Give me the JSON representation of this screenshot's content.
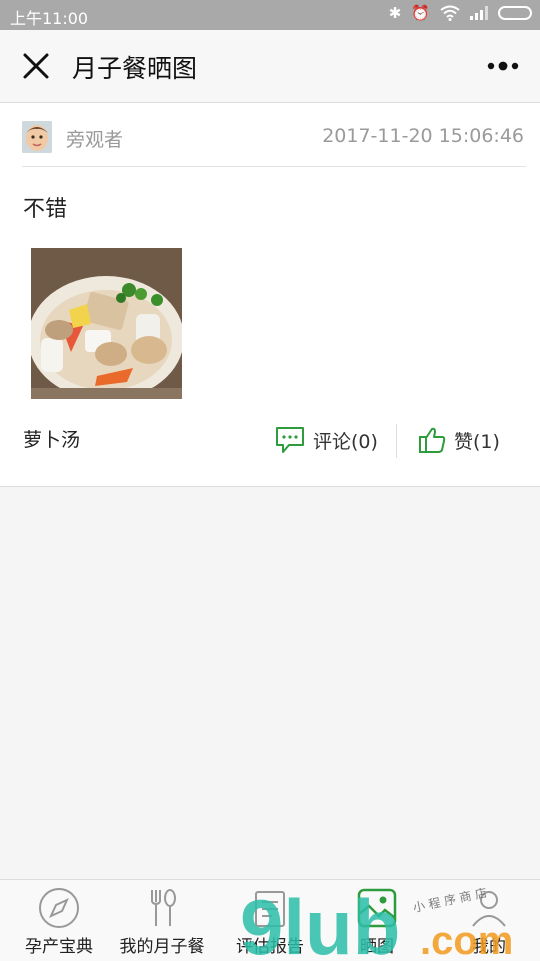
{
  "status_bar": {
    "time": "上午11:00"
  },
  "nav": {
    "title": "月子餐晒图",
    "close_icon": "close-icon",
    "more_icon": "more-icon"
  },
  "post": {
    "author": "旁观者",
    "time": "2017-11-20 15:06:46",
    "text": "不错",
    "caption": "萝卜汤",
    "comment_label": "评论(0)",
    "like_label": "赞(1)",
    "accent_color": "#2e9b3c"
  },
  "tabs": [
    {
      "label": "孕产宝典",
      "icon": "compass-icon"
    },
    {
      "label": "我的月子餐",
      "icon": "fork-spoon-icon"
    },
    {
      "label": "评估报告",
      "icon": "report-icon"
    },
    {
      "label": "晒图",
      "icon": "photo-icon"
    },
    {
      "label": "我的",
      "icon": "user-icon"
    }
  ],
  "watermark": {
    "logo": "9lub",
    "domain": ".com",
    "tagline": "小 程 序 商 店"
  }
}
